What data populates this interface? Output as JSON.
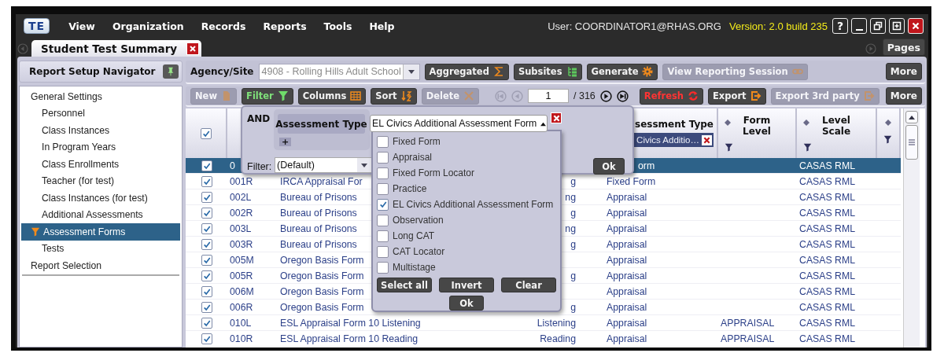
{
  "menubar": {
    "logo": "TE",
    "menus": [
      "View",
      "Organization",
      "Records",
      "Reports",
      "Tools",
      "Help"
    ],
    "user": "User: COORDINATOR1@RHAS.ORG",
    "version": "Version: 2.0 build 235",
    "help": "?"
  },
  "tabs": [
    {
      "label": "Student Test Summary",
      "selected": true
    }
  ],
  "pages_button": "Pages",
  "navigator": {
    "title": "Report Setup Navigator",
    "items": [
      {
        "label": "General Settings",
        "selected": false,
        "filtered": false,
        "children": [
          {
            "label": "Personnel",
            "selected": false,
            "filtered": false
          },
          {
            "label": "Class Instances",
            "selected": false,
            "filtered": false
          },
          {
            "label": "In Program Years",
            "selected": false,
            "filtered": false
          },
          {
            "label": "Class Enrollments",
            "selected": false,
            "filtered": false
          },
          {
            "label": "Teacher (for test)",
            "selected": false,
            "filtered": false
          },
          {
            "label": "Class Instances (for test)",
            "selected": false,
            "filtered": false
          },
          {
            "label": "Additional Assessments",
            "selected": false,
            "filtered": false
          },
          {
            "label": "Assessment Forms",
            "selected": true,
            "filtered": true
          },
          {
            "label": "Tests",
            "selected": false,
            "filtered": false
          }
        ]
      },
      {
        "label": "Report Selection",
        "selected": false,
        "filtered": false
      }
    ]
  },
  "agency": {
    "label": "Agency/Site",
    "value": "4908 - Rolling Hills Adult School"
  },
  "toolbar_1": [
    {
      "label": "Aggregated",
      "kind": "aggregate",
      "disabled": false
    },
    {
      "label": "Subsites",
      "kind": "subsites",
      "disabled": false
    },
    {
      "label": "Generate",
      "kind": "generate",
      "disabled": false
    },
    {
      "label": "View Reporting Session",
      "kind": "session",
      "disabled": true
    }
  ],
  "toolbar_1_more": "More",
  "toolbar_2": [
    {
      "label": "New",
      "kind": "new",
      "disabled": true
    },
    {
      "label": "Filter",
      "kind": "filter",
      "disabled": false
    },
    {
      "label": "Columns",
      "kind": "columns",
      "disabled": false
    },
    {
      "label": "Sort",
      "kind": "sort",
      "disabled": false
    },
    {
      "label": "Delete",
      "kind": "delete",
      "disabled": true
    }
  ],
  "pager": {
    "page": "1",
    "total": "/ 316"
  },
  "toolbar_2_right": [
    {
      "label": "Refresh",
      "kind": "refresh",
      "disabled": false
    },
    {
      "label": "Export",
      "kind": "export",
      "disabled": false
    },
    {
      "label": "Export 3rd party",
      "kind": "export",
      "disabled": true
    }
  ],
  "toolbar_2_more": "More",
  "table": {
    "header_checked": true,
    "columns": [
      {
        "label": "sessment Type",
        "filter": "Civics Additio…"
      },
      {
        "label": "Form Level"
      },
      {
        "label": "Level Scale"
      }
    ],
    "rows": [
      {
        "checked": true,
        "selected": true,
        "code": "0",
        "type": "orm",
        "level_scale": "CASAS RML"
      },
      {
        "checked": true,
        "selected": false,
        "code": "001R",
        "name": "IRCA Appraisal For",
        "column_4": "g",
        "type": "Fixed Form",
        "level_scale": "CASAS RML"
      },
      {
        "checked": true,
        "selected": false,
        "code": "002L",
        "name": "Bureau of Prisons",
        "column_4": "ng",
        "type": "Appraisal",
        "level_scale": "CASAS RML"
      },
      {
        "checked": true,
        "selected": false,
        "code": "002R",
        "name": "Bureau of Prisons",
        "column_4": "g",
        "type": "Appraisal",
        "level_scale": "CASAS RML"
      },
      {
        "checked": true,
        "selected": false,
        "code": "003L",
        "name": "Bureau of Prisons",
        "column_4": "ng",
        "type": "Appraisal",
        "level_scale": "CASAS RML"
      },
      {
        "checked": true,
        "selected": false,
        "code": "003R",
        "name": "Bureau of Prisons",
        "column_4": "g",
        "type": "Appraisal",
        "level_scale": "CASAS RML"
      },
      {
        "checked": true,
        "selected": false,
        "code": "005M",
        "name": "Oregon Basis Form",
        "type": "Appraisal",
        "level_scale": "CASAS RML"
      },
      {
        "checked": true,
        "selected": false,
        "code": "005R",
        "name": "Oregon Basis Form",
        "column_4": "g",
        "type": "Appraisal",
        "level_scale": "CASAS RML"
      },
      {
        "checked": true,
        "selected": false,
        "code": "006M",
        "name": "Oregon Basis Form",
        "type": "Appraisal",
        "level_scale": "CASAS RML"
      },
      {
        "checked": true,
        "selected": false,
        "code": "006R",
        "name": "Oregon Basis Form",
        "column_4": "g",
        "type": "Appraisal",
        "level_scale": "CASAS RML"
      },
      {
        "checked": true,
        "selected": false,
        "code": "010L",
        "name": "ESL Appraisal Form 10 Listening",
        "column_4": "Listening",
        "type": "Appraisal",
        "form_level": "APPRAISAL",
        "level_scale": "CASAS RML"
      },
      {
        "checked": true,
        "selected": false,
        "code": "010R",
        "name": "ESL Appraisal Form 10 Reading",
        "column_4": "Reading",
        "type": "Appraisal",
        "form_level": "APPRAISAL",
        "level_scale": "CASAS RML"
      }
    ]
  },
  "filter_popup": {
    "operator": "AND",
    "field": "Assessment Type",
    "add": "+",
    "filter_label": "Filter:",
    "filter_value": "(Default)",
    "ok": "Ok",
    "combo_value": "EL Civics Additional Assessment Form",
    "options": [
      {
        "label": "Fixed Form",
        "checked": false
      },
      {
        "label": "Appraisal",
        "checked": false
      },
      {
        "label": "Fixed Form Locator",
        "checked": false
      },
      {
        "label": "Practice",
        "checked": false
      },
      {
        "label": "EL Civics Additional Assessment Form",
        "checked": true
      },
      {
        "label": "Observation",
        "checked": false
      },
      {
        "label": "Long CAT",
        "checked": false
      },
      {
        "label": "CAT Locator",
        "checked": false
      },
      {
        "label": "Multistage",
        "checked": false
      }
    ],
    "buttons": [
      "Select all",
      "Invert",
      "Clear"
    ],
    "list_ok": "Ok"
  }
}
